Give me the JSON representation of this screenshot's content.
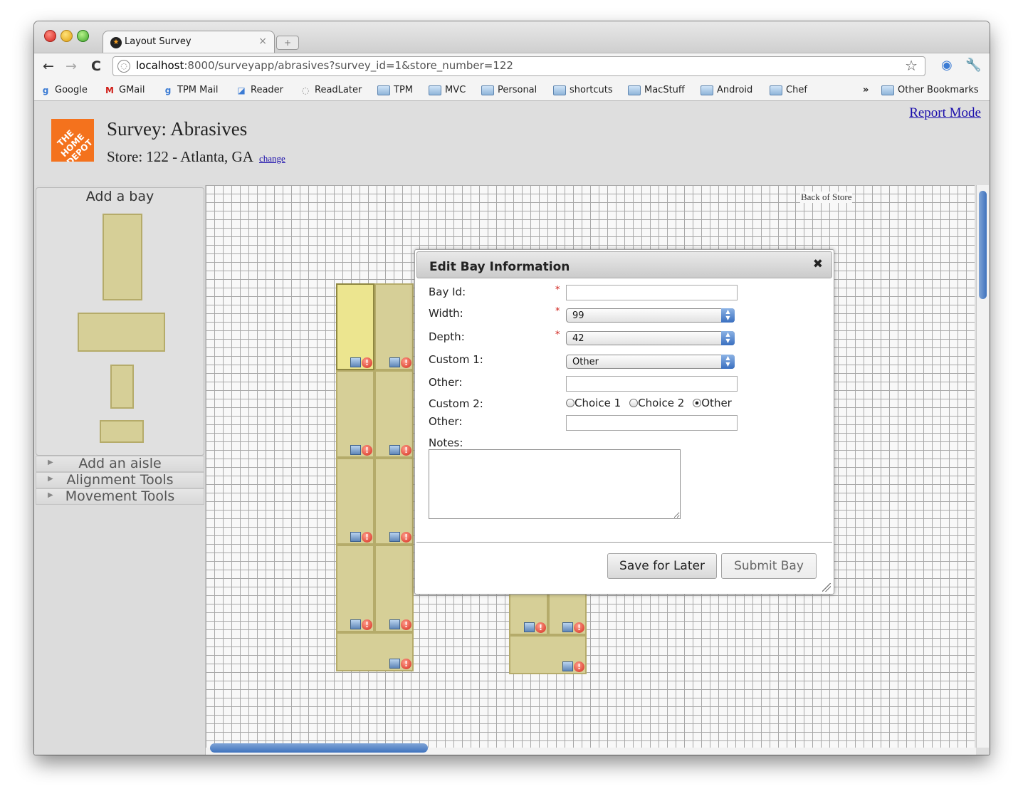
{
  "browser": {
    "tab_title": "Layout Survey",
    "tab_close": "×",
    "new_tab": "+",
    "url_host": "localhost",
    "url_rest": ":8000/surveyapp/abrasives?survey_id=1&store_number=122",
    "back": "←",
    "forward": "→",
    "reload": "C",
    "star": "☆",
    "wrench": "🔧",
    "bookmarks_overflow": "»",
    "bookmarks": [
      {
        "label": "Google",
        "icon": "google-icon"
      },
      {
        "label": "GMail",
        "icon": "gmail-icon"
      },
      {
        "label": "TPM Mail",
        "icon": "google-icon"
      },
      {
        "label": "Reader",
        "icon": "reader-icon"
      },
      {
        "label": "ReadLater",
        "icon": "globe-icon"
      },
      {
        "label": "TPM",
        "icon": "folder-icon"
      },
      {
        "label": "MVC",
        "icon": "folder-icon"
      },
      {
        "label": "Personal",
        "icon": "folder-icon"
      },
      {
        "label": "shortcuts",
        "icon": "folder-icon"
      },
      {
        "label": "MacStuff",
        "icon": "folder-icon"
      },
      {
        "label": "Android",
        "icon": "folder-icon"
      },
      {
        "label": "Chef",
        "icon": "folder-icon"
      }
    ],
    "other_bookmarks": "Other Bookmarks"
  },
  "header": {
    "logo_text": "THE HOME DEPOT",
    "title": "Survey: Abrasives",
    "store": "Store: 122 - Atlanta, GA",
    "change_link": "change",
    "report_mode": "Report Mode"
  },
  "sidebar": {
    "add_bay_title": "Add a bay",
    "sections": [
      "Add an aisle",
      "Alignment Tools",
      "Movement Tools"
    ]
  },
  "canvas": {
    "back_of_store": "Back of Store"
  },
  "dialog": {
    "title": "Edit Bay Information",
    "close": "✖",
    "fields": {
      "bay_id_label": "Bay Id:",
      "bay_id_value": "",
      "width_label": "Width:",
      "width_value": "99",
      "depth_label": "Depth:",
      "depth_value": "42",
      "custom1_label": "Custom 1:",
      "custom1_value": "Other",
      "other1_label": "Other:",
      "other1_value": "",
      "custom2_label": "Custom 2:",
      "custom2_options": [
        "Choice 1",
        "Choice 2",
        "Other"
      ],
      "custom2_selected": "Other",
      "other2_label": "Other:",
      "other2_value": "",
      "notes_label": "Notes:",
      "notes_value": ""
    },
    "required_mark": "*",
    "save_label": "Save for Later",
    "submit_label": "Submit Bay"
  },
  "colors": {
    "bay_fill": "#d6cf97",
    "bay_selected": "#ece58f",
    "link": "#1a0dab",
    "logo": "#f4721d",
    "required": "#d0201a"
  }
}
